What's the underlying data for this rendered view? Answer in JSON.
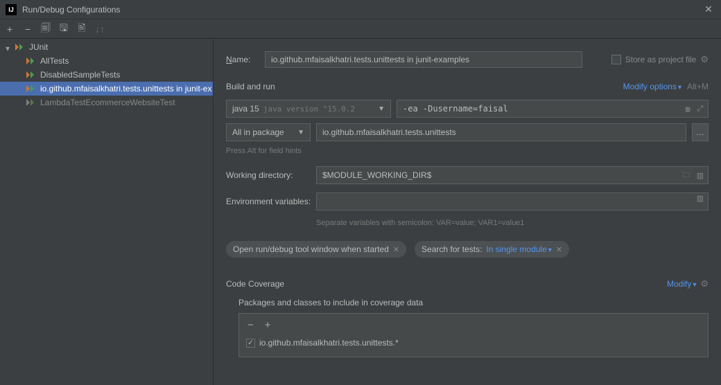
{
  "window": {
    "title": "Run/Debug Configurations"
  },
  "tree": {
    "root": "JUnit",
    "items": [
      {
        "label": "AllTests"
      },
      {
        "label": "DisabledSampleTests"
      },
      {
        "label": "io.github.mfaisalkhatri.tests.unittests in junit-ex",
        "selected": true
      },
      {
        "label": "LambdaTestEcommerceWebsiteTest",
        "muted": true
      }
    ]
  },
  "form": {
    "name_label": "Name:",
    "name_value": "io.github.mfaisalkhatri.tests.unittests in junit-examples",
    "store_label": "Store as project file",
    "build_section": "Build and run",
    "modify_options": "Modify options",
    "modify_shortcut": "Alt+M",
    "jdk_name": "java 15",
    "jdk_version": "java version \"15.0.2",
    "vm_options": "-ea -Dusername=faisal",
    "scope": "All in package",
    "package": "io.github.mfaisalkhatri.tests.unittests",
    "hint": "Press Alt for field hints",
    "wd_label": "Working directory:",
    "wd_value": "$MODULE_WORKING_DIR$",
    "env_label": "Environment variables:",
    "env_hint": "Separate variables with semicolon: VAR=value; VAR1=value1",
    "chip1": "Open run/debug tool window when started",
    "chip2_label": "Search for tests:",
    "chip2_value": "In single module",
    "coverage_section": "Code Coverage",
    "modify_label": "Modify",
    "cov_label": "Packages and classes to include in coverage data",
    "cov_entry": "io.github.mfaisalkhatri.tests.unittests.*"
  }
}
